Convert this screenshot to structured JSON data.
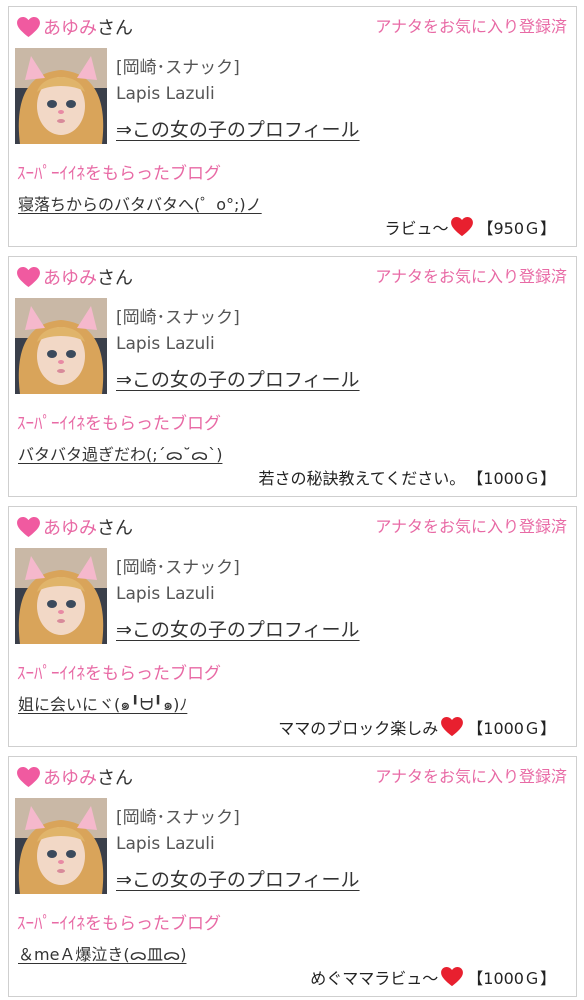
{
  "colors": {
    "accent": "#e86aa5",
    "border": "#cfcfcf",
    "heart_red": "#e8202f"
  },
  "cards": [
    {
      "name": "あゆみ",
      "honorific": "さん",
      "favorite_label": "アナタをお気に入り登録済",
      "area_type": "[岡崎･スナック]",
      "shop": "Lapis Lazuli",
      "profile_link": "⇒この女の子のプロフィール",
      "section_title": "ｽｰﾊﾟｰｲｲﾈをもらったブログ",
      "blog_title": "寝落ちからのバタバタへ(゜o°;)ノ",
      "gift_message": "ラビュ〜",
      "gift_has_heart": true,
      "gift_price": "【950Ｇ】"
    },
    {
      "name": "あゆみ",
      "honorific": "さん",
      "favorite_label": "アナタをお気に入り登録済",
      "area_type": "[岡崎･スナック]",
      "shop": "Lapis Lazuli",
      "profile_link": "⇒この女の子のプロフィール",
      "section_title": "ｽｰﾊﾟｰｲｲﾈをもらったブログ",
      "blog_title": "バタバタ過ぎだわ(;´ᯅ˘ᯅ`)",
      "gift_message": "若さの秘訣教えてください。",
      "gift_has_heart": false,
      "gift_price": "【1000Ｇ】"
    },
    {
      "name": "あゆみ",
      "honorific": "さん",
      "favorite_label": "アナタをお気に入り登録済",
      "area_type": "[岡崎･スナック]",
      "shop": "Lapis Lazuli",
      "profile_link": "⇒この女の子のプロフィール",
      "section_title": "ｽｰﾊﾟｰｲｲﾈをもらったブログ",
      "blog_title": "姐に会いにヾ(๑╹ᗨ╹๑)ﾉ",
      "gift_message": "ママのブロック楽しみ",
      "gift_has_heart": true,
      "gift_price": "【1000Ｇ】"
    },
    {
      "name": "あゆみ",
      "honorific": "さん",
      "favorite_label": "アナタをお気に入り登録済",
      "area_type": "[岡崎･スナック]",
      "shop": "Lapis Lazuli",
      "profile_link": "⇒この女の子のプロフィール",
      "section_title": "ｽｰﾊﾟｰｲｲﾈをもらったブログ",
      "blog_title": "＆meＡ爆泣き(ᯅ皿ᯅ)",
      "gift_message": "めぐママラビュ〜",
      "gift_has_heart": true,
      "gift_price": "【1000Ｇ】"
    }
  ]
}
